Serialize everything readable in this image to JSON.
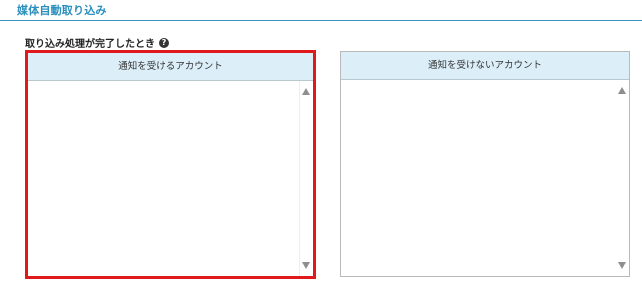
{
  "section": {
    "title": "媒体自動取り込み"
  },
  "notify_on_complete": {
    "label": "取り込み処理が完了したとき",
    "help_icon_glyph": "?"
  },
  "panels": {
    "notify": {
      "header": "通知を受けるアカウント",
      "items": [],
      "highlighted": true,
      "highlight_color": "#e0191d"
    },
    "no_notify": {
      "header": "通知を受けないアカウント",
      "items": []
    }
  },
  "colors": {
    "accent": "#2a8fbd",
    "header_bg": "#dceff9"
  }
}
